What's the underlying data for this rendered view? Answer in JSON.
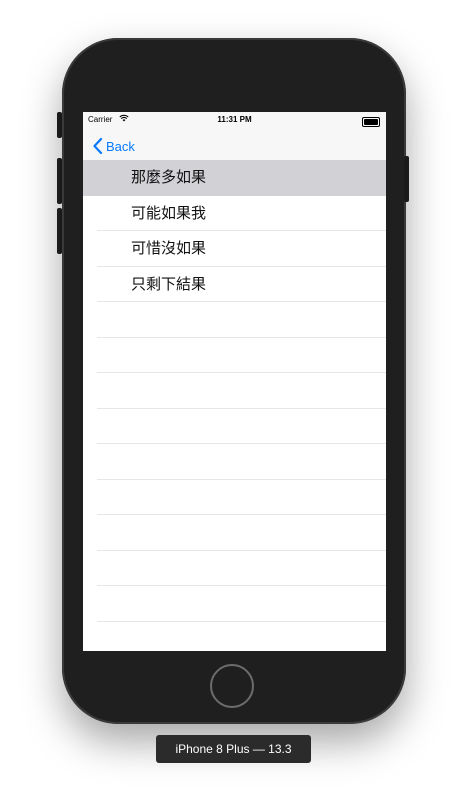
{
  "status_bar": {
    "carrier": "Carrier",
    "time": "11:31 PM"
  },
  "nav_bar": {
    "back_label": "Back"
  },
  "table": {
    "rows": [
      {
        "label": "那麼多如果",
        "selected": true
      },
      {
        "label": "可能如果我",
        "selected": false
      },
      {
        "label": "可惜沒如果",
        "selected": false
      },
      {
        "label": "只剩下結果",
        "selected": false
      },
      {
        "label": "",
        "selected": false
      },
      {
        "label": "",
        "selected": false
      },
      {
        "label": "",
        "selected": false
      },
      {
        "label": "",
        "selected": false
      },
      {
        "label": "",
        "selected": false
      },
      {
        "label": "",
        "selected": false
      },
      {
        "label": "",
        "selected": false
      },
      {
        "label": "",
        "selected": false
      },
      {
        "label": "",
        "selected": false
      },
      {
        "label": "",
        "selected": false
      }
    ]
  },
  "simulator": {
    "device_label": "iPhone 8 Plus — 13.3"
  },
  "colors": {
    "tint": "#0a7aff",
    "selected_row": "#d1d1d6",
    "separator": "#e5e5ea"
  }
}
